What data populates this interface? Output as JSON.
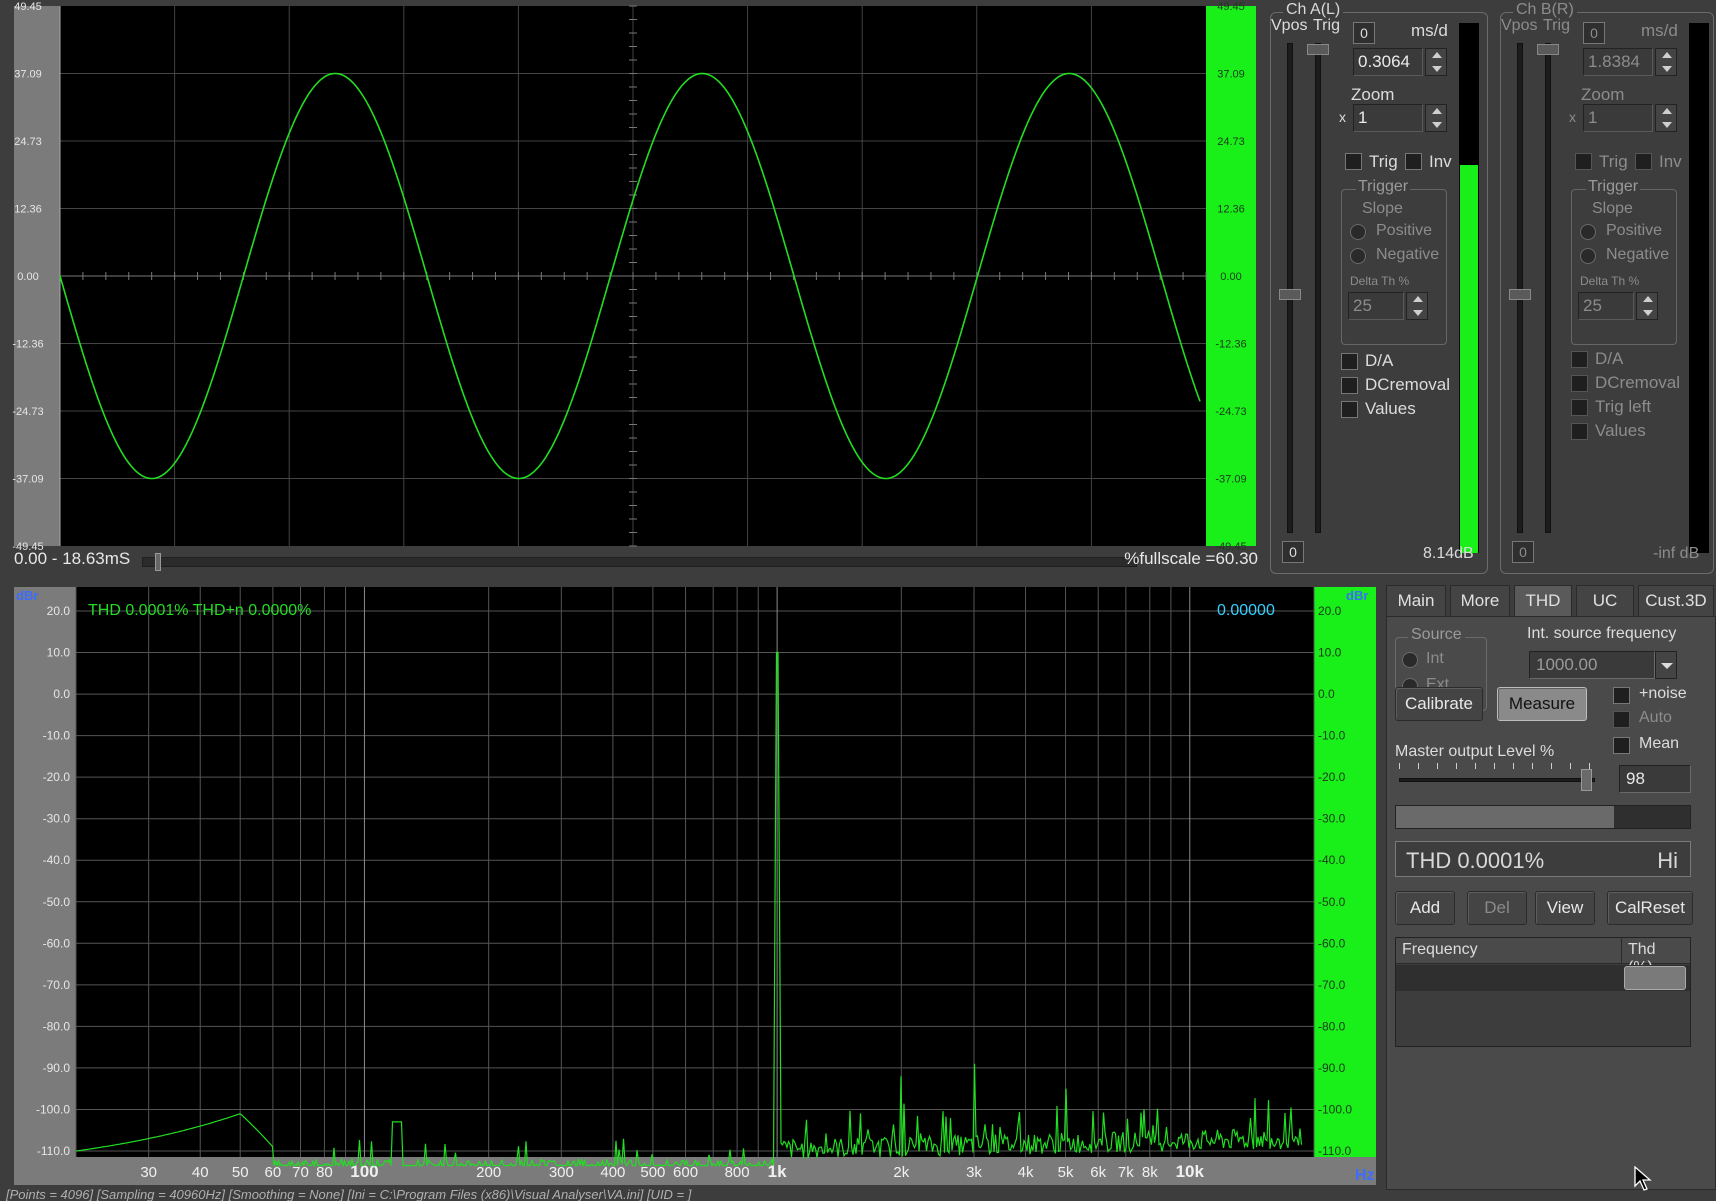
{
  "scope": {
    "y_ticks": [
      "49.45",
      "37.09",
      "24.73",
      "12.36",
      "0.00",
      "-12.36",
      "-24.73",
      "-37.09",
      "-49.45"
    ],
    "time_range": "0.00 - 18.63mS",
    "fullscale": "%fullscale =60.30"
  },
  "chA": {
    "title": "Ch A(L)",
    "vpos_label": "Vpos",
    "trig_label": "Trig",
    "small_box": "0",
    "ms_label": "ms/d",
    "ms_value": "0.3064",
    "zoom_label": "Zoom",
    "zoom_x": "x",
    "zoom_value": "1",
    "trig_check": "Trig",
    "inv_check": "Inv",
    "trigger_group": "Trigger",
    "slope_label": "Slope",
    "positive": "Positive",
    "negative": "Negative",
    "delta_label": "Delta Th %",
    "delta_value": "25",
    "da": "D/A",
    "dcremoval": "DCremoval",
    "values": "Values",
    "bottom_box": "0",
    "level": "8.14dB"
  },
  "chB": {
    "title": "Ch B(R)",
    "vpos_label": "Vpos",
    "trig_label": "Trig",
    "small_box": "0",
    "ms_label": "ms/d",
    "ms_value": "1.8384",
    "zoom_label": "Zoom",
    "zoom_x": "x",
    "zoom_value": "1",
    "trig_check": "Trig",
    "inv_check": "Inv",
    "trigger_group": "Trigger",
    "slope_label": "Slope",
    "positive": "Positive",
    "negative": "Negative",
    "delta_label": "Delta Th %",
    "delta_value": "25",
    "da": "D/A",
    "dcremoval": "DCremoval",
    "trig_left": "Trig left",
    "values": "Values",
    "bottom_box": "0",
    "level": "-inf dB"
  },
  "spectrum": {
    "unit_left": "dBr",
    "unit_right": "dBr",
    "thd_text": "THD 0.0001% THD+n 0.0000%",
    "cursor_value": "0.00000",
    "y_ticks": [
      "20.0",
      "10.0",
      "0.0",
      "-10.0",
      "-20.0",
      "-30.0",
      "-40.0",
      "-50.0",
      "-60.0",
      "-70.0",
      "-80.0",
      "-90.0",
      "-100.0",
      "-110.0"
    ],
    "x_ticks": [
      "30",
      "40",
      "50",
      "60",
      "70",
      "80",
      "100",
      "200",
      "300",
      "400",
      "500",
      "600",
      "800",
      "1k",
      "2k",
      "3k",
      "4k",
      "5k",
      "6k",
      "7k",
      "8k",
      "10k"
    ],
    "x_unit": "Hz"
  },
  "thd_panel": {
    "tabs": [
      "Main",
      "More",
      "THD",
      "UC",
      "Cust.3D"
    ],
    "active_tab": "THD",
    "source_group": "Source",
    "source_int": "Int",
    "source_ext": "Ext",
    "int_freq_label": "Int. source frequency",
    "int_freq_value": "1000.00",
    "noise_check": "+noise",
    "auto_check": "Auto",
    "mean_check": "Mean",
    "calibrate": "Calibrate",
    "measure": "Measure",
    "master_level_label": "Master output Level %",
    "master_level_value": "98",
    "master_level": 98,
    "progress": 0.74,
    "thd_readout": "THD 0.0001%",
    "thd_hi": "Hi",
    "add": "Add",
    "del": "Del",
    "view": "View",
    "calreset": "CalReset",
    "table_headers": [
      "Frequency",
      "Thd (%)"
    ]
  },
  "status": {
    "text": "[Points = 4096]  [Sampling = 40960Hz]  [Smoothing = None]  [Ini = C:\\Program Files (x86)\\Visual Analyser\\VA.ini]  [UID = ]"
  },
  "colors": {
    "trace": "#22dd22",
    "green_bar": "#19ef19",
    "cyan": "#35d0ff",
    "blue_label": "#3b6dff"
  }
}
